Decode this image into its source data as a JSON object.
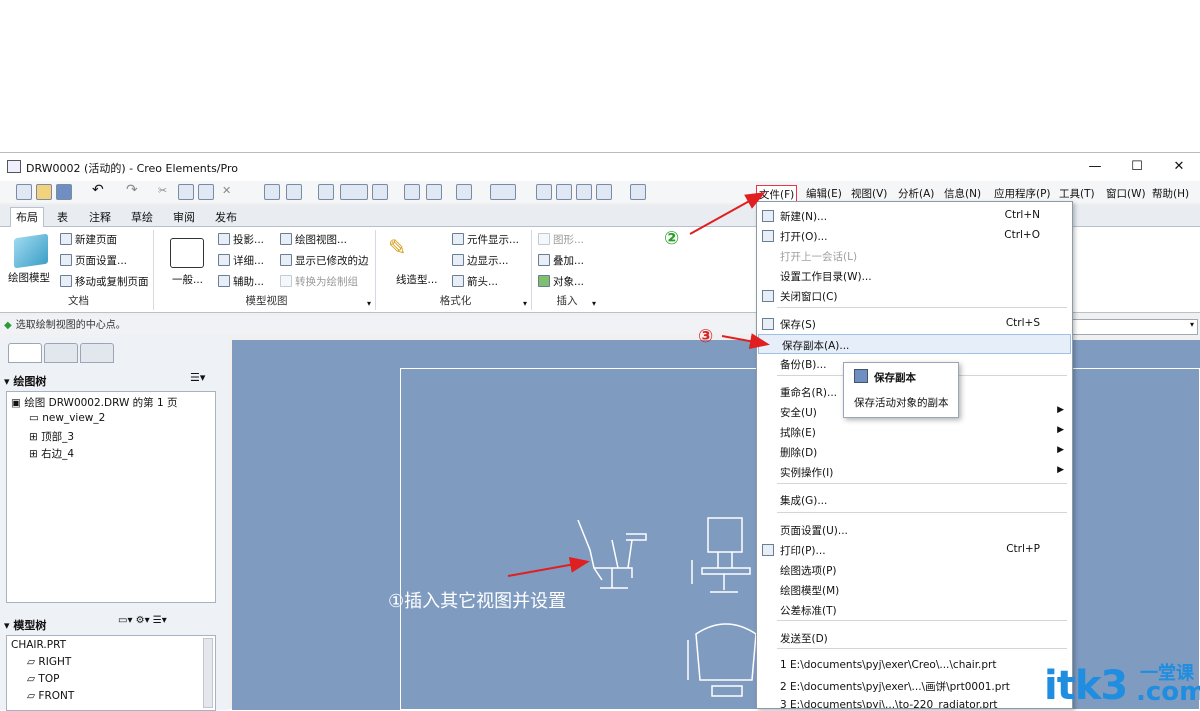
{
  "window": {
    "title": "DRW0002 (活动的) - Creo Elements/Pro",
    "minimize": "—",
    "maximize": "☐",
    "close": "✕"
  },
  "menubar": [
    "文件(F)",
    "编辑(E)",
    "视图(V)",
    "分析(A)",
    "信息(N)",
    "应用程序(P)",
    "工具(T)",
    "窗口(W)",
    "帮助(H)"
  ],
  "tabs": [
    "布局",
    "表",
    "注释",
    "草绘",
    "审阅",
    "发布"
  ],
  "ribbon": {
    "doc": {
      "big": "绘图模型",
      "items": [
        "新建页面",
        "页面设置...",
        "移动或复制页面"
      ],
      "label": "文档"
    },
    "model": {
      "big": "一般...",
      "col1": [
        "投影...",
        "详细...",
        "辅助..."
      ],
      "col2": [
        "绘图视图...",
        "显示已修改的边",
        "转换为绘制组"
      ],
      "label": "模型视图"
    },
    "format": {
      "big": "线造型...",
      "items": [
        "元件显示...",
        "边显示...",
        "箭头..."
      ],
      "label": "格式化"
    },
    "insert": {
      "items": [
        "图形...",
        "叠加...",
        "对象..."
      ],
      "label": "插入"
    }
  },
  "status": "选取绘制视图的中心点。",
  "drawing_tree": {
    "header": "绘图树",
    "items": [
      "绘图 DRW0002.DRW 的第 1 页",
      "new_view_2",
      "顶部_3",
      "右边_4"
    ]
  },
  "model_tree": {
    "header": "模型树",
    "items": [
      "CHAIR.PRT",
      "RIGHT",
      "TOP",
      "FRONT"
    ]
  },
  "annotations": {
    "a1": "①插入其它视图并设置",
    "a2": "②",
    "a3": "③"
  },
  "file_menu": [
    {
      "label": "新建(N)...",
      "shortcut": "Ctrl+N"
    },
    {
      "label": "打开(O)...",
      "shortcut": "Ctrl+O"
    },
    {
      "label": "打开上一会话(L)",
      "disabled": true
    },
    {
      "label": "设置工作目录(W)..."
    },
    {
      "label": "关闭窗口(C)"
    },
    {
      "label": "保存(S)",
      "shortcut": "Ctrl+S"
    },
    {
      "label": "保存副本(A)..."
    },
    {
      "label": "备份(B)..."
    },
    {
      "label": "重命名(R)..."
    },
    {
      "label": "安全(U)"
    },
    {
      "label": "拭除(E)"
    },
    {
      "label": "删除(D)"
    },
    {
      "label": "实例操作(I)"
    },
    {
      "label": "集成(G)..."
    },
    {
      "label": "页面设置(U)..."
    },
    {
      "label": "打印(P)...",
      "shortcut": "Ctrl+P"
    },
    {
      "label": "绘图选项(P)"
    },
    {
      "label": "绘图模型(M)"
    },
    {
      "label": "公差标准(T)"
    },
    {
      "label": "发送至(D)"
    },
    {
      "label": "1 E:\\documents\\pyj\\exer\\Creo\\...\\chair.prt"
    },
    {
      "label": "2 E:\\documents\\pyj\\exer\\...\\画饼\\prt0001.prt"
    },
    {
      "label": "3 E:\\documents\\pyj\\...\\to-220_radiator.prt"
    }
  ],
  "tooltip": {
    "title": "保存副本",
    "desc": "保存活动对象的副本"
  },
  "watermark": {
    "main": "itk3",
    "sub1": "一堂课",
    ".com": ".com"
  },
  "colors": {
    "canvas": "#7f9bc0",
    "arrow": "#e02020",
    "accent_green": "#2a9a3a"
  }
}
